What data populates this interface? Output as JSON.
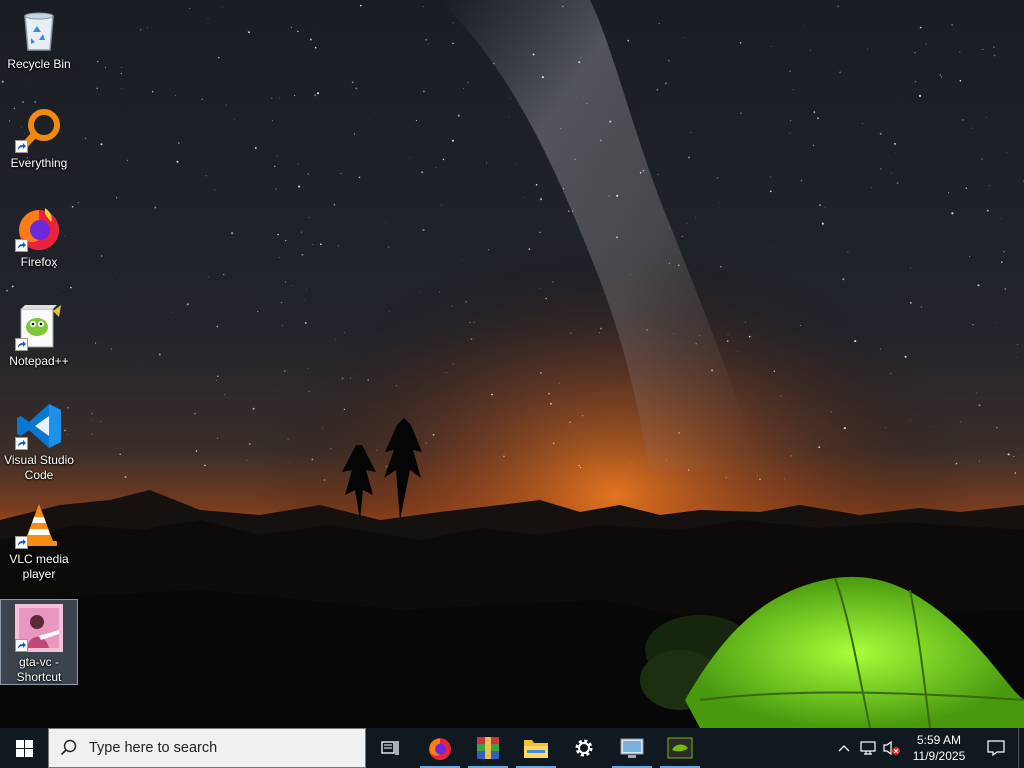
{
  "desktop": {
    "icons": [
      {
        "label": "Recycle Bin",
        "icon": "recycle-bin-icon",
        "shortcut": false
      },
      {
        "label": "Everything",
        "icon": "everything-search-icon",
        "shortcut": true
      },
      {
        "label": "Firefox",
        "icon": "firefox-icon",
        "shortcut": true
      },
      {
        "label": "Notepad++",
        "icon": "notepad-plus-plus-icon",
        "shortcut": true
      },
      {
        "label": "Visual Studio Code",
        "icon": "vscode-icon",
        "shortcut": true
      },
      {
        "label": "VLC media player",
        "icon": "vlc-icon",
        "shortcut": true
      },
      {
        "label": "gta-vc - Shortcut",
        "icon": "gta-vc-icon",
        "shortcut": true,
        "selected": true
      }
    ]
  },
  "taskbar": {
    "search_placeholder": "Type here to search",
    "pinned": [
      {
        "name": "task-view",
        "icon": "task-view-icon"
      },
      {
        "name": "firefox",
        "icon": "firefox-icon",
        "running": true
      },
      {
        "name": "winrar",
        "icon": "winrar-icon",
        "running": true
      },
      {
        "name": "file-explorer",
        "icon": "folder-icon",
        "running": true
      },
      {
        "name": "settings",
        "icon": "gear-icon"
      },
      {
        "name": "remote-desktop",
        "icon": "remote-desktop-icon",
        "running": true
      },
      {
        "name": "nvidia",
        "icon": "nvidia-icon",
        "running": true
      }
    ],
    "clock": {
      "time": "5:59 AM",
      "date": "11/9/2025"
    },
    "tray_icons": [
      "chevron-up-icon",
      "network-icon",
      "volume-muted-icon",
      "notification-icon"
    ]
  },
  "colors": {
    "taskbar_bg": "#101820",
    "search_bg": "#f0f0f0",
    "accent": "#6aa8e0",
    "tent_green": "#7ad22a",
    "horizon_orange": "#e0651a"
  }
}
